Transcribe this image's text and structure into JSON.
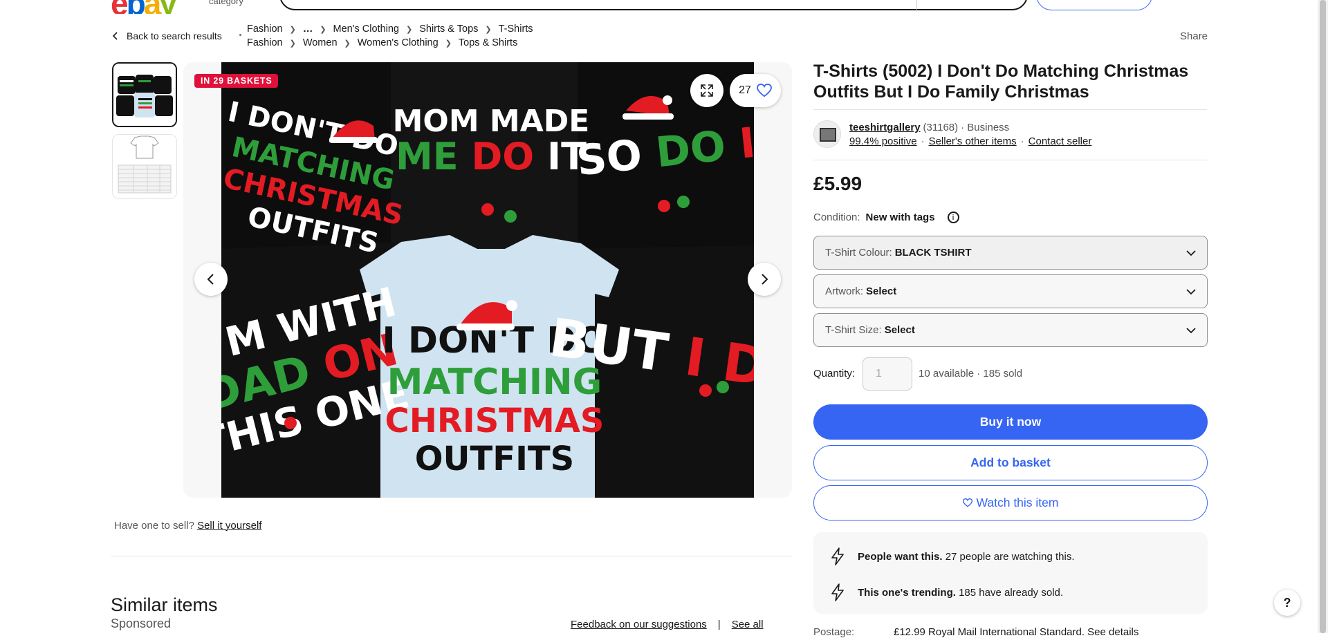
{
  "header": {
    "logo_e": "e",
    "logo_b": "b",
    "logo_a": "a",
    "logo_y": "y",
    "shop_category": "category"
  },
  "nav": {
    "back_label": "Back to search results",
    "share_label": "Share",
    "breadcrumb_row1": [
      "Fashion",
      "…",
      "Men's Clothing",
      "Shirts & Tops",
      "T-Shirts"
    ],
    "breadcrumb_row2": [
      "Fashion",
      "Women",
      "Women's Clothing",
      "Tops & Shirts"
    ]
  },
  "gallery": {
    "badge": "IN 29 BASKETS",
    "watch_count": "27",
    "photo_texts": {
      "t1": "I DON'T DO MATCHING CHRISTMAS OUTFITS",
      "t2": "MOM MADE ME DO IT",
      "t3": "SO DO I",
      "t4": "I'M WITH DAD ON THIS ONE",
      "t5": "I DON'T DO MATCHING CHRISTMAS OUTFITS",
      "t6": "BUT I DO"
    }
  },
  "sell": {
    "question": "Have one to sell?",
    "link": "Sell it yourself"
  },
  "similar": {
    "title": "Similar items",
    "sponsored": "Sponsored",
    "feedback": "Feedback on our suggestions",
    "divider": "|",
    "see_all": "See all"
  },
  "item": {
    "title": "T-Shirts (5002) I Don't Do Matching Christmas Outfits But I Do Family Christmas",
    "price": "£5.99",
    "condition_label": "Condition:",
    "condition_value": "New with tags",
    "quantity_label": "Quantity:",
    "quantity_value": "1",
    "availability": "10 available · 185 sold"
  },
  "seller": {
    "name": "teeshirtgallery",
    "feedback_count": "(31168)",
    "type": "· Business",
    "positive": "99.4% positive",
    "other_items": "Seller's other items",
    "contact": "Contact seller"
  },
  "variations": [
    {
      "label": "T-Shirt Colour:",
      "value": "BLACK TSHIRT"
    },
    {
      "label": "Artwork:",
      "value": "Select"
    },
    {
      "label": "T-Shirt Size:",
      "value": "Select"
    }
  ],
  "actions": {
    "buy": "Buy it now",
    "basket": "Add to basket",
    "watch": "Watch this item"
  },
  "signals": [
    {
      "bold": "People want this.",
      "text": "27 people are watching this."
    },
    {
      "bold": "This one's trending.",
      "text": "185 have already sold."
    }
  ],
  "postage": {
    "label": "Postage:",
    "value": "£12.99 Royal Mail International Standard. See details"
  },
  "help": "?",
  "colors": {
    "accent": "#3665f3",
    "badge": "#e0103a",
    "text": "#191919",
    "muted": "#555555"
  }
}
